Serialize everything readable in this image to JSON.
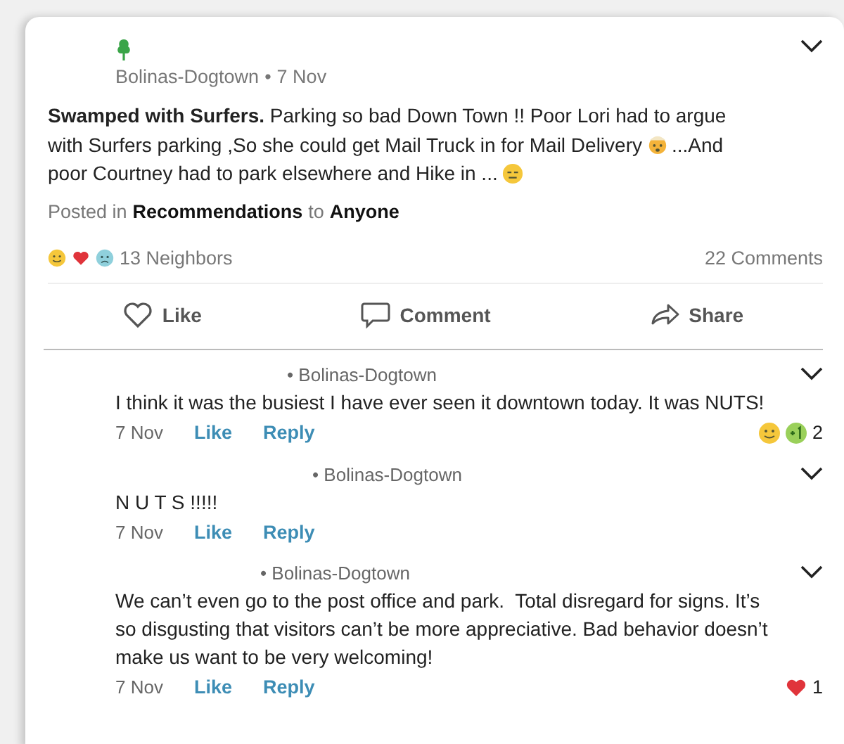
{
  "post": {
    "neighborhood": "Bolinas-Dogtown",
    "separator": "•",
    "date": "7 Nov",
    "body": [
      [
        {
          "kind": "text",
          "text": "**Swamped with Surfers.** Parking so bad Down Town !! Poor Lori had to argue"
        }
      ],
      [
        {
          "kind": "text",
          "text": "with Surfers parking ,So she could get Mail Truck in for Mail Delivery"
        },
        {
          "kind": "exploding-head"
        },
        {
          "kind": "text",
          "text": "...And"
        }
      ],
      [
        {
          "kind": "text",
          "text": "poor Courtney had to park elsewhere and Hike in ..."
        },
        {
          "kind": "expressionless"
        }
      ]
    ],
    "posted_in": {
      "prefix": "Posted in",
      "category": "Recommendations",
      "joiner": "to",
      "audience": "Anyone"
    },
    "reactions": [
      {
        "kind": "smile"
      },
      {
        "kind": "heart"
      },
      {
        "kind": "sad"
      }
    ],
    "reaction_count": "13 Neighbors",
    "comment_count": "22 Comments",
    "actions": [
      {
        "kind": "like",
        "label": "Like"
      },
      {
        "kind": "comment",
        "label": "Comment"
      },
      {
        "kind": "share",
        "label": "Share"
      }
    ]
  },
  "comments": [
    {
      "author_suffix": "• Bolinas-Dogtown",
      "lines": [
        "I think it was the busiest I have ever seen it downtown today. It was NUTS!"
      ],
      "date": "7 Nov",
      "like": "Like",
      "reply": "Reply",
      "reactions": [
        {
          "kind": "smile"
        },
        {
          "kind": "plus-one"
        }
      ],
      "reaction_count": "2"
    },
    {
      "author_suffix": "• Bolinas-Dogtown",
      "lines": [
        "N U T S !!!!!"
      ],
      "date": "7 Nov",
      "like": "Like",
      "reply": "Reply"
    },
    {
      "author_suffix": "• Bolinas-Dogtown",
      "lines": [
        "We can’t even go to the post office and park.  Total disregard for signs. It’s",
        "so disgusting that visitors can’t be more appreciative. Bad behavior doesn’t",
        "make us want to be very welcoming!"
      ],
      "date": "7 Nov",
      "like": "Like",
      "reply": "Reply",
      "reactions": [
        {
          "kind": "heart"
        }
      ],
      "reaction_count": "1"
    }
  ]
}
